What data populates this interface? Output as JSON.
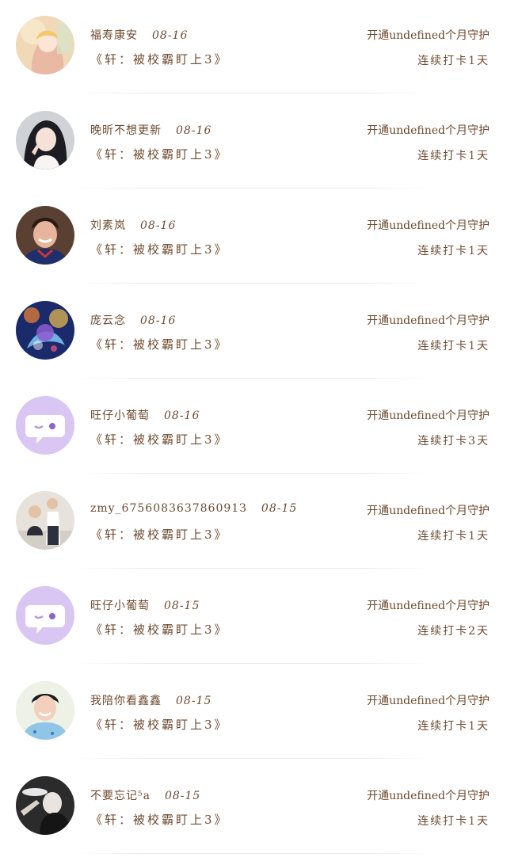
{
  "items": [
    {
      "name": "福寿康安",
      "date": "08-16",
      "book": "《轩：被校霸盯上3》",
      "guard": "开通undefined个月守护",
      "streak": "连续打卡1天",
      "avatar": "illustrated-girl-avatar"
    },
    {
      "name": "晚昕不想更新",
      "date": "08-16",
      "book": "《轩：被校霸盯上3》",
      "guard": "开通undefined个月守护",
      "streak": "连续打卡1天",
      "avatar": "girl-photo-avatar"
    },
    {
      "name": "刘素岚",
      "date": "08-16",
      "book": "《轩：被校霸盯上3》",
      "guard": "开通undefined个月守护",
      "streak": "连续打卡1天",
      "avatar": "boy-photo-avatar"
    },
    {
      "name": "庞云念",
      "date": "08-16",
      "book": "《轩：被校霸盯上3》",
      "guard": "开通undefined个月守护",
      "streak": "连续打卡1天",
      "avatar": "fantasy-art-avatar"
    },
    {
      "name": "旺仔小葡萄",
      "date": "08-16",
      "book": "《轩：被校霸盯上3》",
      "guard": "开通undefined个月守护",
      "streak": "连续打卡3天",
      "avatar": "default-chat-bubble-avatar"
    },
    {
      "name": "zmy_675608363786091З",
      "date": "08-15",
      "book": "《轩：被校霸盯上3》",
      "guard": "开通undefined个月守护",
      "streak": "连续打卡1天",
      "avatar": "two-people-photo-avatar"
    },
    {
      "name": "旺仔小葡萄",
      "date": "08-15",
      "book": "《轩：被校霸盯上3》",
      "guard": "开通undefined个月守护",
      "streak": "连续打卡2天",
      "avatar": "default-chat-bubble-avatar"
    },
    {
      "name": "我陪你看鑫鑫",
      "date": "08-15",
      "book": "《轩：被校霸盯上3》",
      "guard": "开通undefined个月守护",
      "streak": "连续打卡1天",
      "avatar": "smiling-boy-photo-avatar"
    },
    {
      "name": "不要忘记⁵a",
      "date": "08-15",
      "book": "《轩：被校霸盯上3》",
      "guard": "开通undefined个月守护",
      "streak": "连续打卡1天",
      "avatar": "dark-photo-avatar"
    }
  ]
}
